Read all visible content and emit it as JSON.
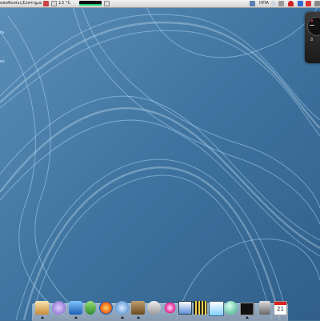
{
  "top_panel": {
    "menu_places": "οποθεσίες",
    "menu_system": "Σύστημα",
    "weather_temp": "13 °C",
    "clock_label": "ΗΠΑ"
  },
  "desktop": {
    "label_1": "ta",
    "label_2": "es"
  },
  "clock_widget": {
    "time_text": "8"
  },
  "dock": {
    "calendar_day": "21"
  }
}
